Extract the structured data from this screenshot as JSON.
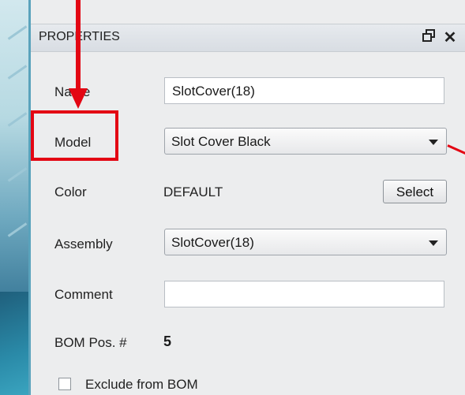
{
  "panel": {
    "title": "PROPERTIES",
    "pin_icon": "pin-icon",
    "close_icon": "close-icon",
    "close_glyph": "✕",
    "pin_glyph": "🗗"
  },
  "fields": {
    "name": {
      "label": "Name",
      "value": "SlotCover(18)"
    },
    "model": {
      "label": "Model",
      "value": "Slot Cover Black"
    },
    "color": {
      "label": "Color",
      "value": "DEFAULT",
      "button_label": "Select"
    },
    "assembly": {
      "label": "Assembly",
      "value": "SlotCover(18)"
    },
    "comment": {
      "label": "Comment",
      "value": ""
    },
    "bom_pos": {
      "label": "BOM Pos. #",
      "value": "5"
    },
    "exclude_from_bom": {
      "label": "Exclude from BOM",
      "checked": false
    }
  },
  "annotation_color": "#e30613"
}
